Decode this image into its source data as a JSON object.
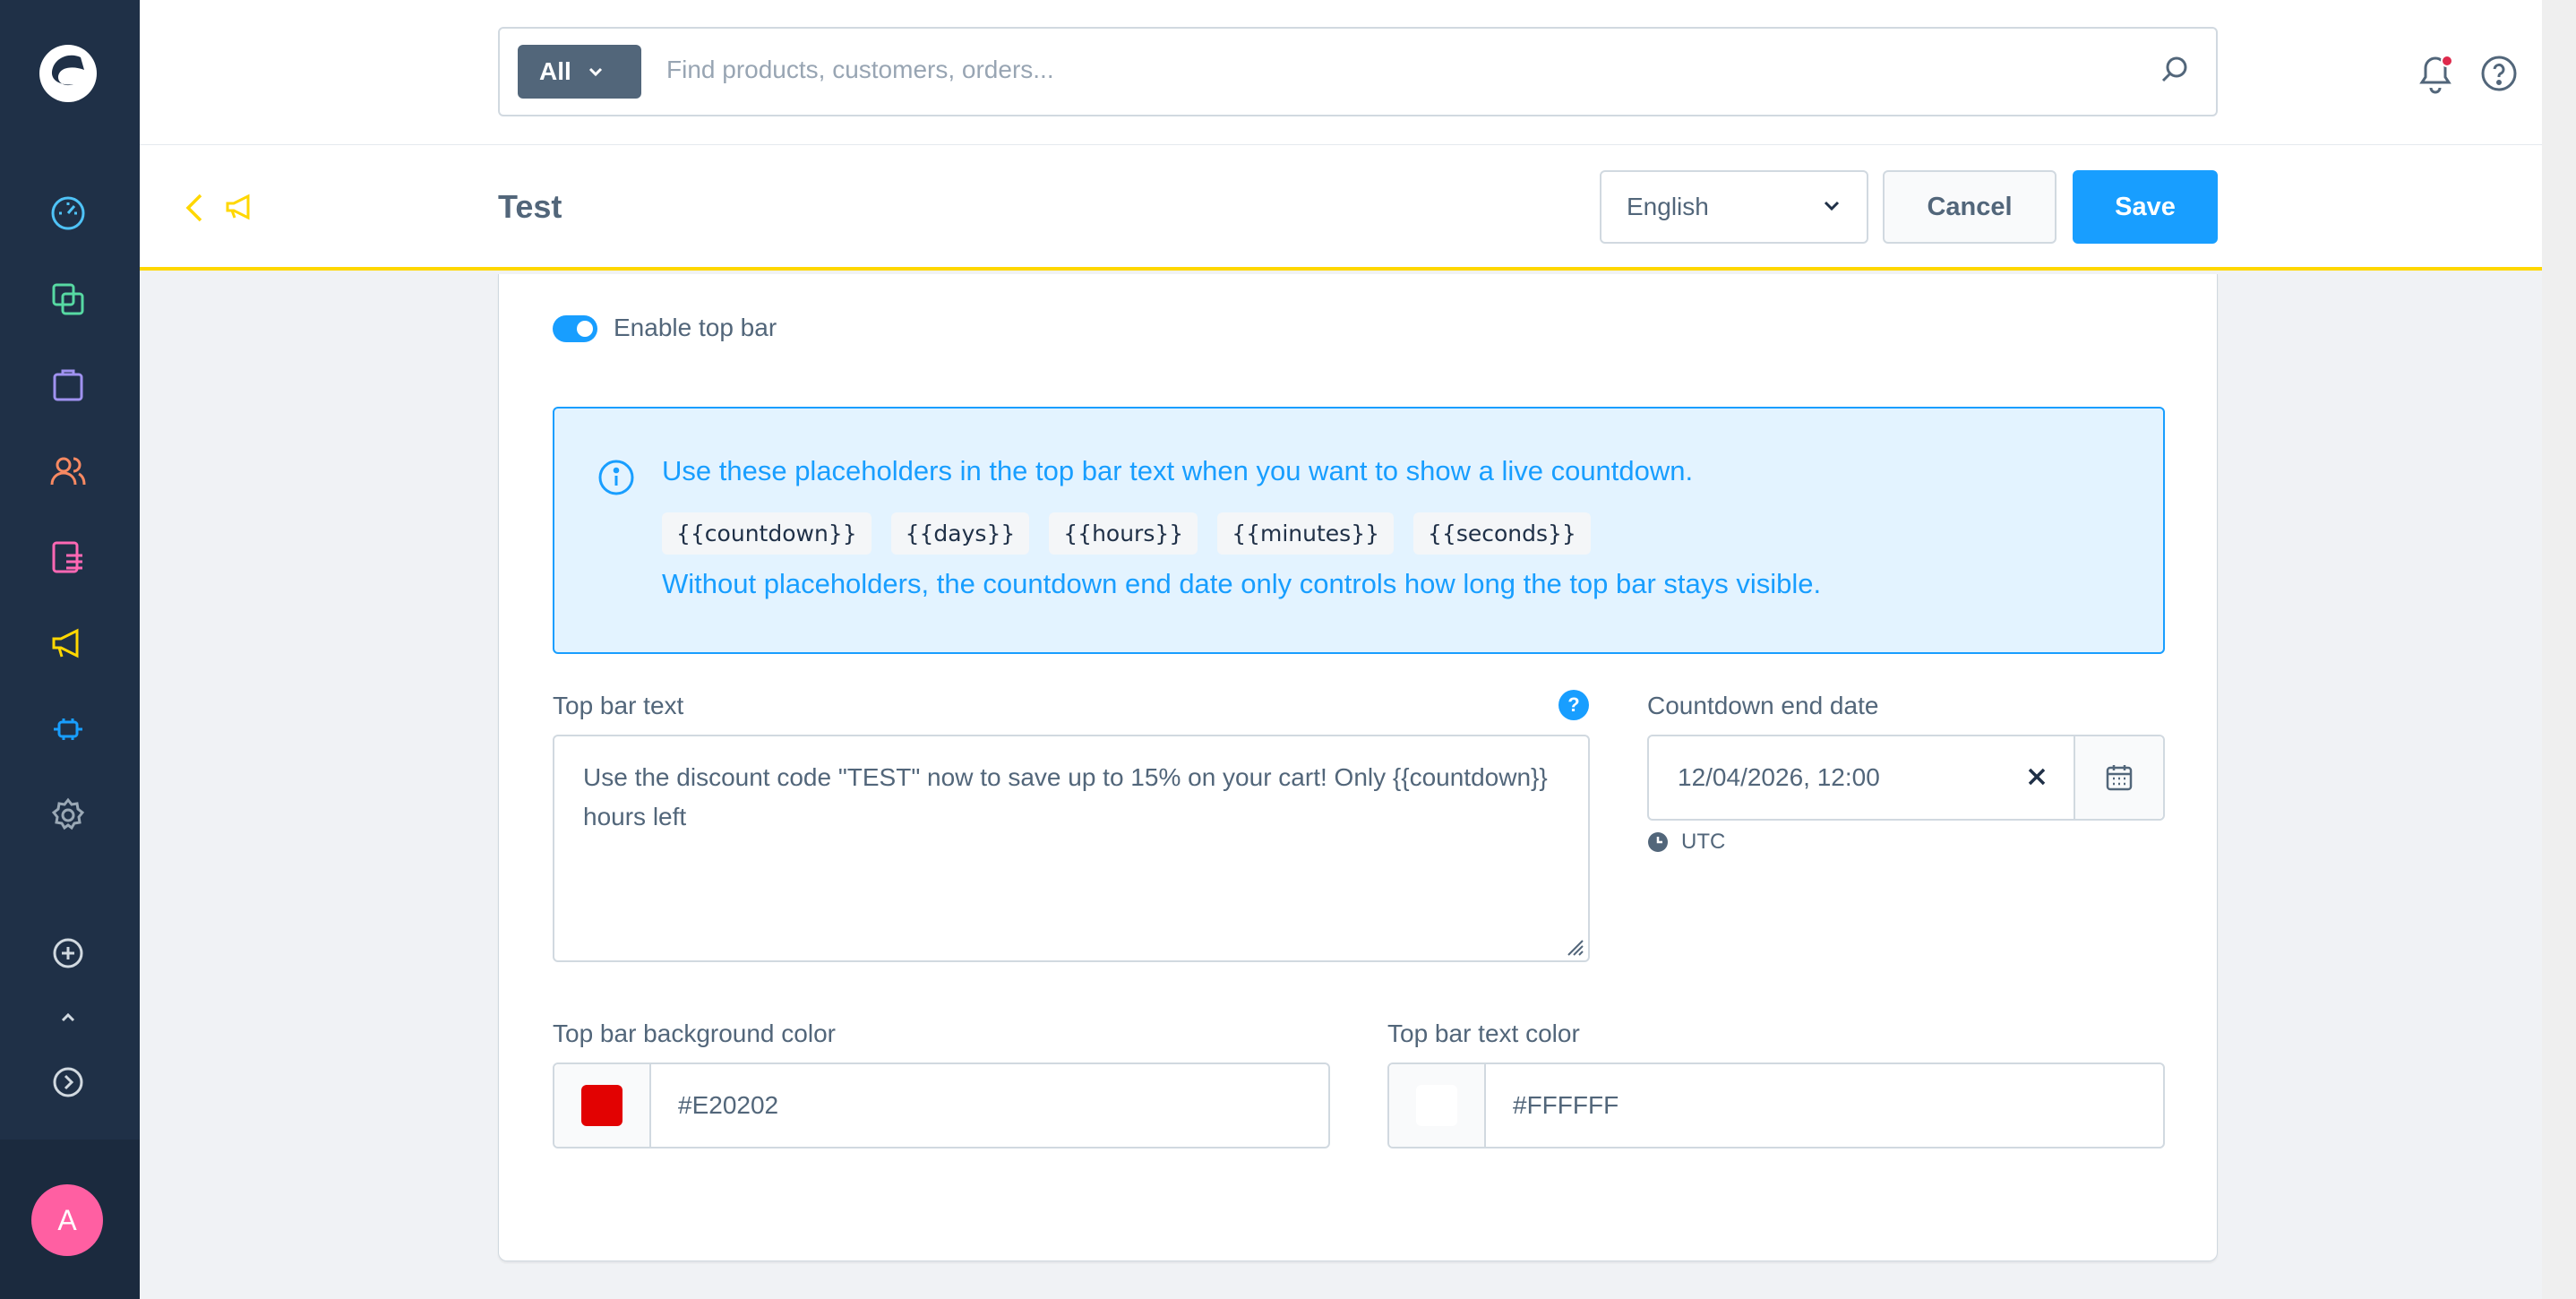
{
  "search": {
    "scope_label": "All",
    "placeholder": "Find products, customers, orders..."
  },
  "page": {
    "title": "Test"
  },
  "actions": {
    "language": "English",
    "cancel_label": "Cancel",
    "save_label": "Save"
  },
  "avatar": {
    "initial": "A",
    "color": "#ff5fa2"
  },
  "form": {
    "toggle_label": "Enable top bar",
    "toggle_on": true,
    "info": {
      "line1": "Use these placeholders in the top bar text when you want to show a live countdown.",
      "placeholders": [
        "{{countdown}}",
        "{{days}}",
        "{{hours}}",
        "{{minutes}}",
        "{{seconds}}"
      ],
      "line2": "Without placeholders, the countdown end date only controls how long the top bar stays visible."
    },
    "text_label": "Top bar text",
    "text_value": "Use the discount code \"TEST\" now to save up to 15% on your cart! Only {{countdown}} hours left",
    "countdown_label": "Countdown end date",
    "countdown_value": "12/04/2026, 12:00",
    "timezone": "UTC",
    "bg_color_label": "Top bar background color",
    "bg_color_value": "#E20202",
    "text_color_label": "Top bar text color",
    "text_color_value": "#FFFFFF"
  },
  "colors": {
    "accent": "#189eff",
    "sidebar": "#1f3047",
    "module_highlight": "#ffd700"
  },
  "icons": {
    "sidebar": [
      "dashboard-icon",
      "catalog-icon",
      "orders-icon",
      "customers-icon",
      "content-icon",
      "marketing-icon",
      "extensions-icon",
      "settings-icon",
      "add-icon",
      "collapse-icon",
      "next-icon"
    ]
  }
}
